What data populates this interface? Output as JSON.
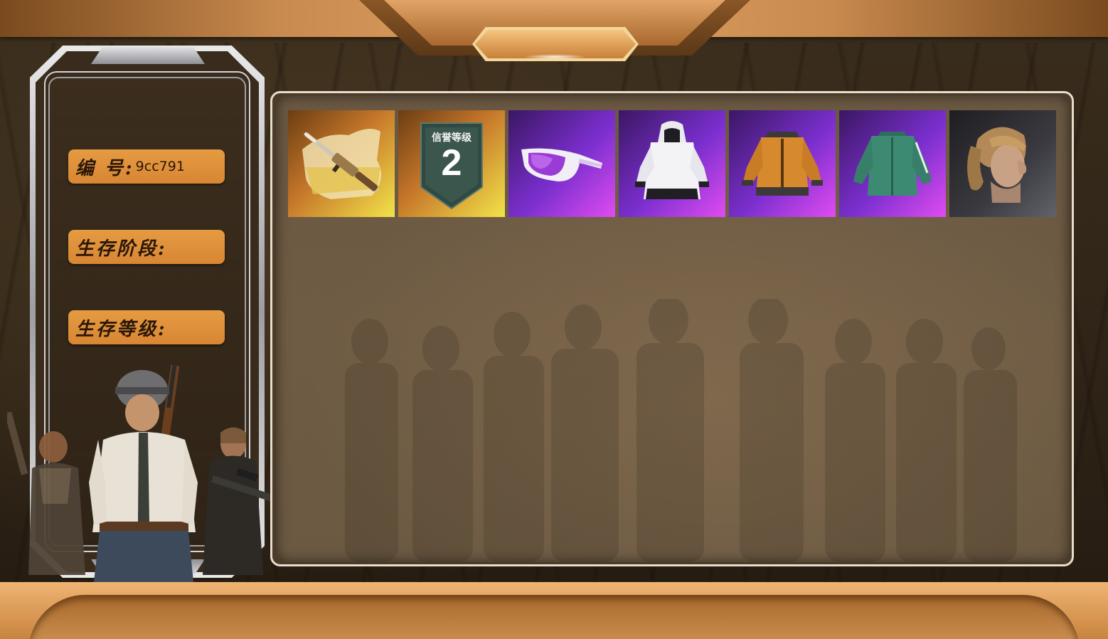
{
  "profile": {
    "id_label": "编 号:",
    "id_value": "9cc791",
    "stage_label": "生存阶段:",
    "stage_value": "",
    "level_label": "生存等级:",
    "level_value": ""
  },
  "items": [
    {
      "name": "rifle-skin",
      "rarity_color": "#e7c83a",
      "icon": "rifle-icon"
    },
    {
      "name": "credit-level-badge",
      "rarity_color": "#e7c83a",
      "icon": "shield-badge-icon",
      "title": "信誉等级",
      "value": "2"
    },
    {
      "name": "sunglasses",
      "rarity_color": "#c447e6",
      "icon": "sunglasses-icon"
    },
    {
      "name": "white-hoodie",
      "rarity_color": "#c447e6",
      "icon": "hoodie-icon"
    },
    {
      "name": "orange-jacket",
      "rarity_color": "#c447e6",
      "icon": "jacket-icon"
    },
    {
      "name": "green-shirt",
      "rarity_color": "#c447e6",
      "icon": "shirt-icon"
    },
    {
      "name": "female-head",
      "rarity_color": "#5e5e66",
      "icon": "character-head-icon"
    }
  ],
  "colors": {
    "frame_accent": "#e0a262",
    "label_bg": "#e59b42",
    "panel_bg": "#6a5842"
  }
}
